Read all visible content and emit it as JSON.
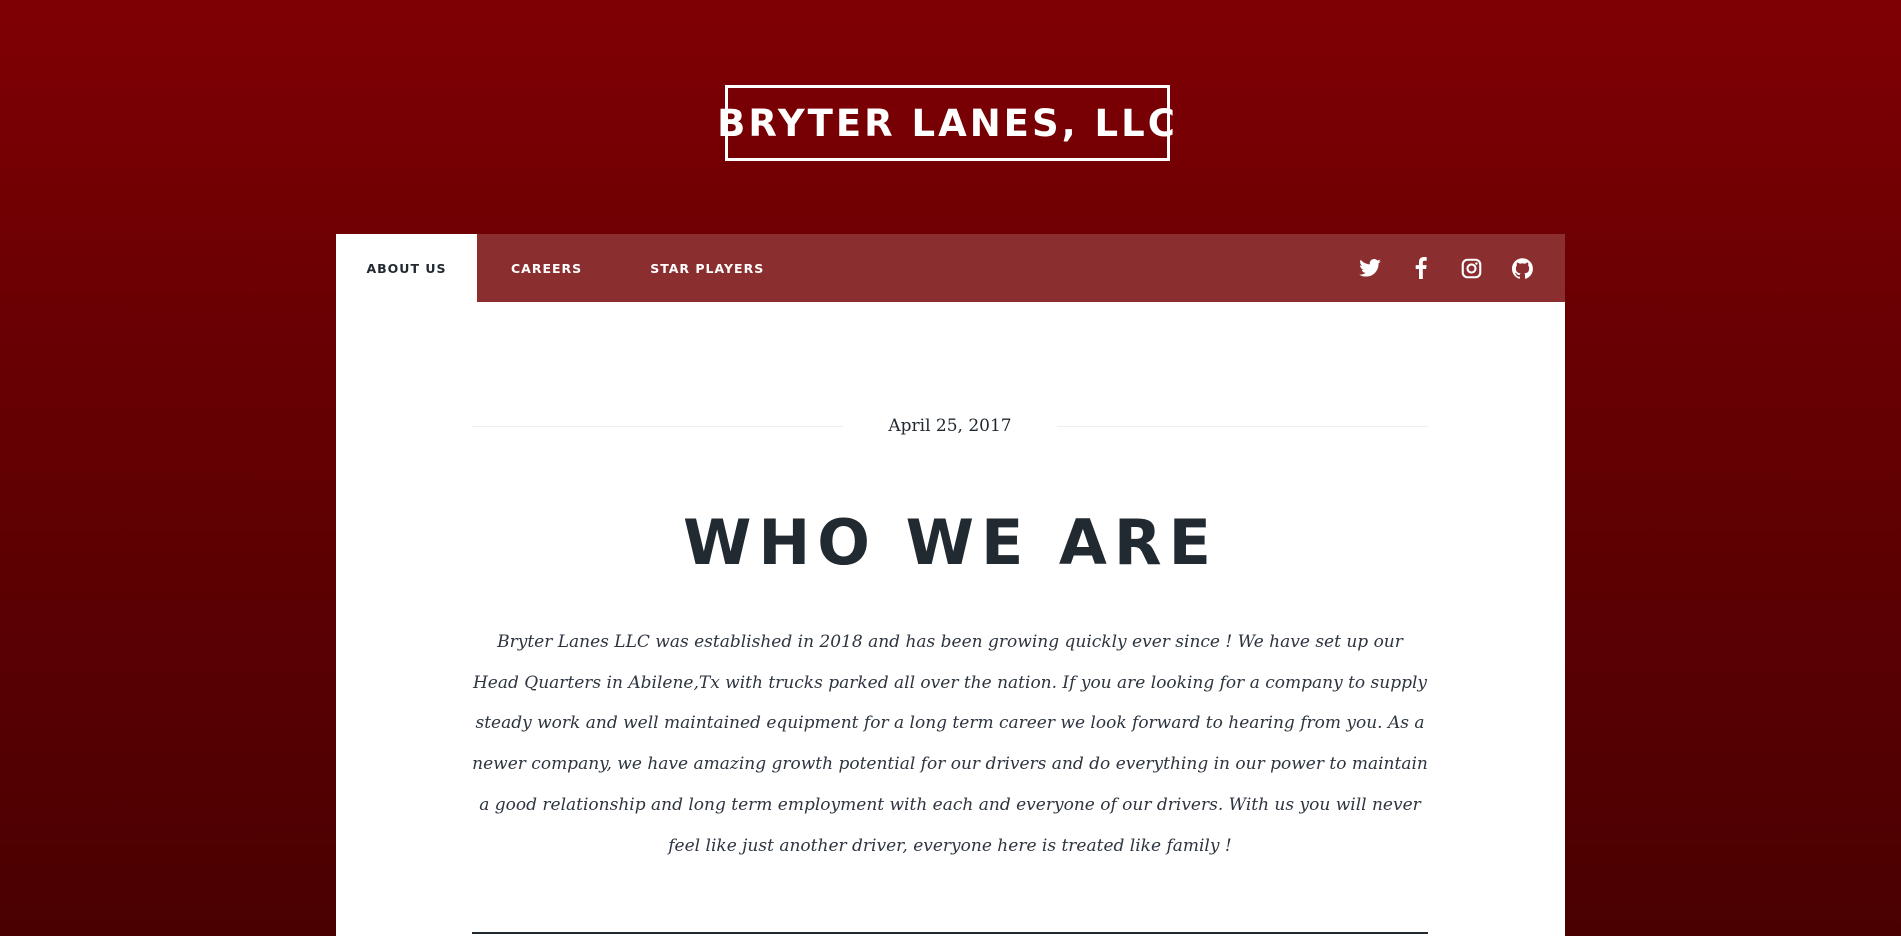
{
  "site": {
    "title": "BRYTER LANES, LLC"
  },
  "nav": {
    "items": [
      {
        "label": "ABOUT US",
        "active": true
      },
      {
        "label": "CAREERS",
        "active": false
      },
      {
        "label": "STAR PLAYERS",
        "active": false
      }
    ],
    "icons": [
      "twitter-icon",
      "facebook-icon",
      "instagram-icon",
      "github-icon"
    ]
  },
  "post": {
    "date": "April 25, 2017",
    "heading": "WHO WE ARE",
    "body": "Bryter Lanes LLC was established in 2018 and has been growing quickly ever since ! We have set up our Head Quarters in Abilene,Tx with trucks parked all over the nation. If you are looking for a company to supply steady work and well maintained equipment for a long term career we look forward to hearing from you. As a newer company, we have amazing growth potential for our drivers and do everything in our power to maintain a good relationship and long term employment with each and everyone of our drivers. With us you will never feel like just another driver, everyone here is treated like family !"
  },
  "colors": {
    "background_top": "#7f0004",
    "background_bottom": "#4a0001",
    "nav_bar": "#8b2e2f",
    "text_dark": "#212931"
  }
}
